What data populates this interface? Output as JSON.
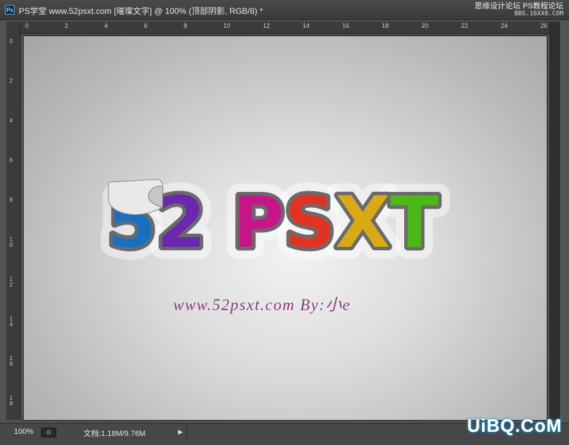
{
  "window": {
    "app_badge": "Ps",
    "title": "PS学堂 www.52psxt.com [璀璨文字] @ 100% (顶部阴影, RGB/8) *"
  },
  "watermark_top": {
    "line1": "思缘设计论坛  PS教程论坛",
    "line2": "BBS.16XX8.COM"
  },
  "ruler": {
    "h_labels": [
      "0",
      "2",
      "4",
      "6",
      "8",
      "10",
      "12",
      "14",
      "16",
      "18",
      "20",
      "22",
      "24",
      "26"
    ],
    "v_labels": [
      "0",
      "2",
      "4",
      "6",
      "8",
      "1\n0",
      "1\n2",
      "1\n4",
      "1\n6",
      "1\n8"
    ]
  },
  "canvas": {
    "logo_digits": [
      "5",
      "2"
    ],
    "logo_letters": [
      "P",
      "S",
      "X",
      "T"
    ],
    "logo_colors": [
      "#1f7fd8",
      "#7a2fc4",
      "#e01b9c",
      "#ff3a2a",
      "#f7c21a",
      "#57d21a"
    ],
    "byline": "www.52psxt.com  By:小e"
  },
  "status": {
    "zoom": "100%",
    "icon": "efficiency-icon",
    "doc_info": "文档:1.18M/9.76M",
    "arrow": "▶"
  },
  "watermark_bottom": "UiBQ.CoM"
}
